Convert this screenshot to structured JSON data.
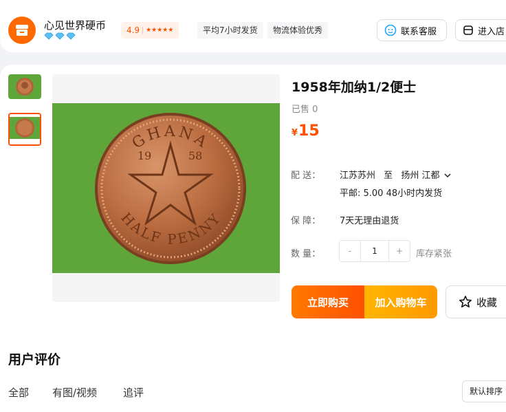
{
  "shop": {
    "name": "心见世界硬币",
    "rating": "4.9",
    "tags": [
      "平均7小时发货",
      "物流体验优秀"
    ],
    "contact_label": "联系客服",
    "enter_label": "进入店"
  },
  "product": {
    "title": "1958年加纳1/2便士",
    "sold": "已售 0",
    "currency": "¥",
    "price": "15",
    "coin_text": {
      "country": "GHANA",
      "year_left": "19",
      "year_right": "58",
      "denomination": "HALF PENNY"
    },
    "shipping": {
      "label": "配    送：",
      "from": "江苏苏州",
      "to_word": "至",
      "to": "扬州 江都",
      "detail": "平邮: 5.00   48小时内发货"
    },
    "guarantee": {
      "label": "保    障：",
      "value": "7天无理由退货"
    },
    "quantity": {
      "label": "数    量：",
      "minus": "-",
      "value": "1",
      "plus": "+",
      "stock": "库存紧张"
    },
    "buy_now": "立即购买",
    "add_cart": "加入购物车",
    "favorite": "收藏"
  },
  "reviews": {
    "title": "用户评价",
    "tabs": [
      "全部",
      "有图/视频",
      "追评"
    ],
    "sort": "默认排序"
  },
  "colors": {
    "accent": "#ff5000",
    "logo": "#ff6a00",
    "coin": "#b0643a",
    "background_green": "#5ea63a"
  }
}
